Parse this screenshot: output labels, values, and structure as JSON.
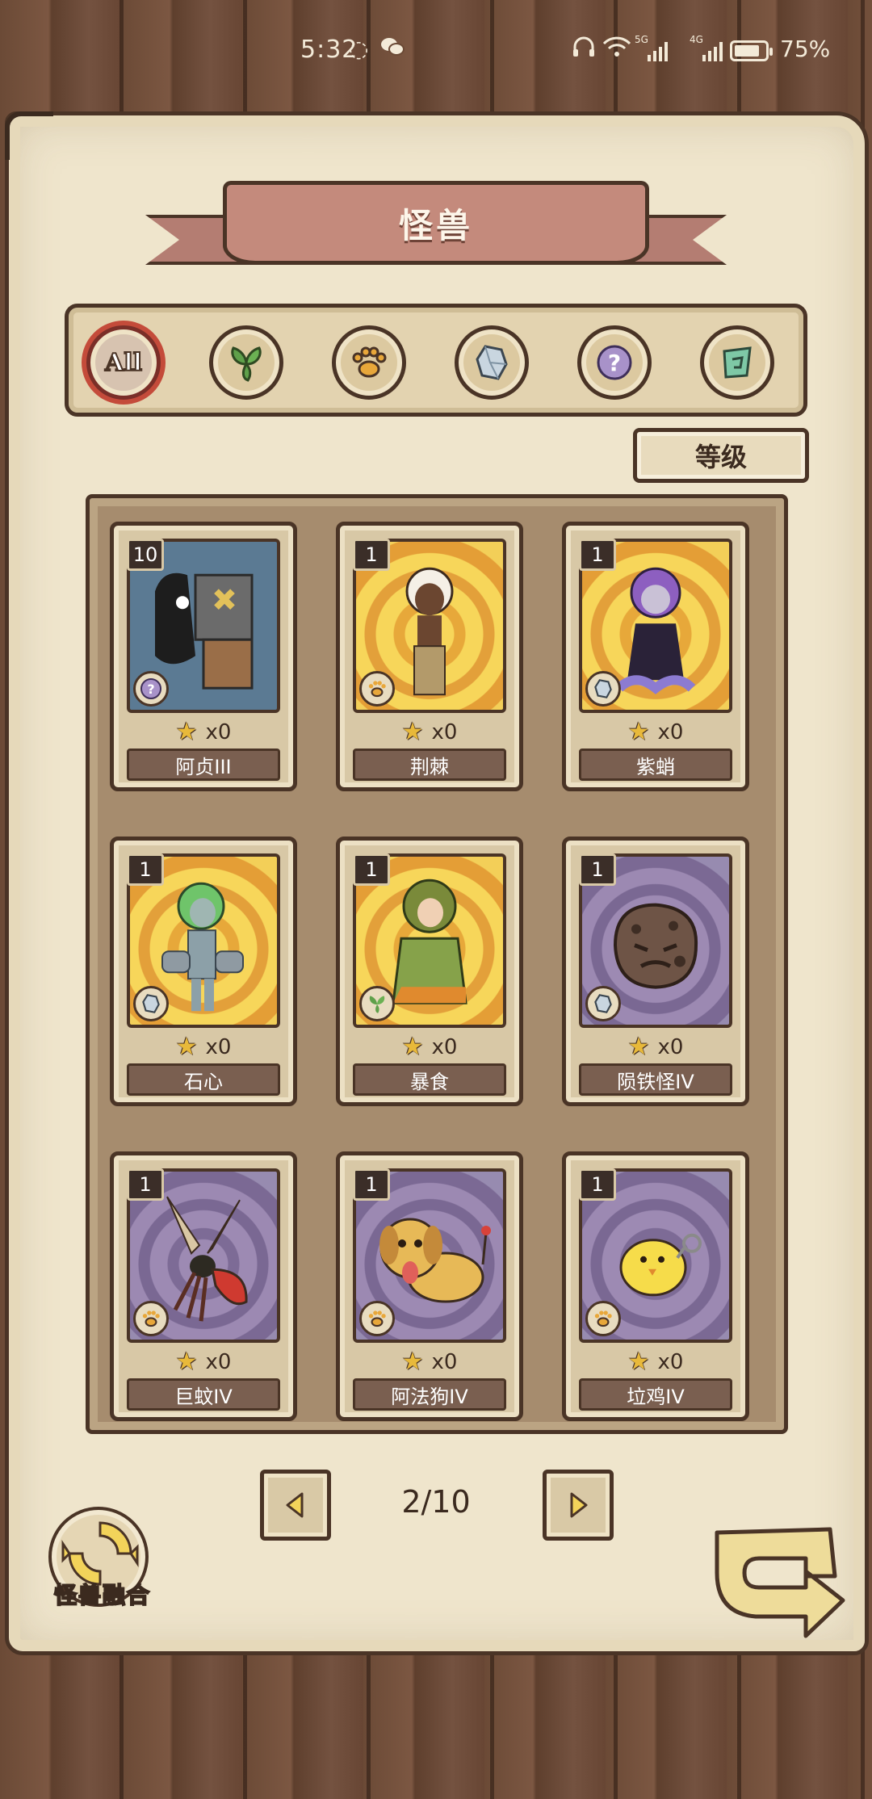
{
  "status_bar": {
    "time": "5:32",
    "battery_percent": "75%",
    "network_1": "5G",
    "network_2": "4G"
  },
  "screen": {
    "title": "怪兽",
    "filters": [
      {
        "label": "All",
        "icon": "all-icon",
        "selected": true
      },
      {
        "label": "",
        "icon": "leaf-icon",
        "selected": false
      },
      {
        "label": "",
        "icon": "paw-icon",
        "selected": false
      },
      {
        "label": "",
        "icon": "crystal-icon",
        "selected": false
      },
      {
        "label": "",
        "icon": "question-icon",
        "selected": false
      },
      {
        "label": "",
        "icon": "spiral-icon",
        "selected": false
      }
    ],
    "sort_label": "等级"
  },
  "cards": [
    {
      "level": "10",
      "name": "阿贞III",
      "stars": "x0",
      "type_icon": "question-icon",
      "background": "blue"
    },
    {
      "level": "1",
      "name": "荆棘",
      "stars": "x0",
      "type_icon": "paw-icon",
      "background": "yellow"
    },
    {
      "level": "1",
      "name": "紫蛸",
      "stars": "x0",
      "type_icon": "crystal-icon",
      "background": "yellow"
    },
    {
      "level": "1",
      "name": "石心",
      "stars": "x0",
      "type_icon": "crystal-icon",
      "background": "yellow"
    },
    {
      "level": "1",
      "name": "暴食",
      "stars": "x0",
      "type_icon": "leaf-icon",
      "background": "yellow"
    },
    {
      "level": "1",
      "name": "陨铁怪IV",
      "stars": "x0",
      "type_icon": "crystal-icon",
      "background": "purple"
    },
    {
      "level": "1",
      "name": "巨蚊IV",
      "stars": "x0",
      "type_icon": "paw-icon",
      "background": "purple"
    },
    {
      "level": "1",
      "name": "阿法狗IV",
      "stars": "x0",
      "type_icon": "paw-icon",
      "background": "purple"
    },
    {
      "level": "1",
      "name": "垃鸡IV",
      "stars": "x0",
      "type_icon": "paw-icon",
      "background": "purple"
    }
  ],
  "pagination": {
    "current": 2,
    "total": 10,
    "label": "2/10"
  },
  "fusion": {
    "label": "怪兽融合"
  },
  "colors": {
    "accent_red": "#c44b3a",
    "card_name_bg": "#7a5f50",
    "star": "#e8b93a",
    "parchment": "#efe5cc"
  }
}
